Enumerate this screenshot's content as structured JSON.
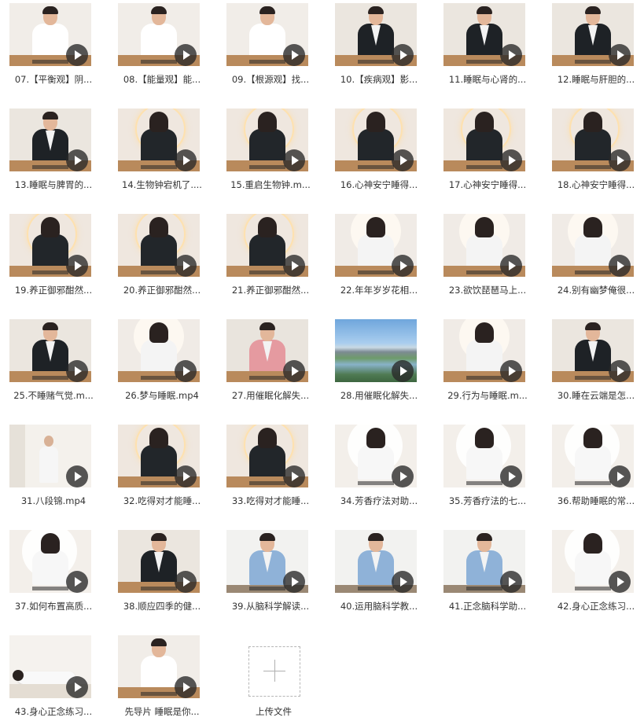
{
  "files": [
    {
      "name": "07.【平衡观】阴...",
      "scene": "man-navy"
    },
    {
      "name": "08.【能量观】能...",
      "scene": "man-navy"
    },
    {
      "name": "09.【根源观】找...",
      "scene": "man-navy"
    },
    {
      "name": "10.【疾病观】影...",
      "scene": "man-dark"
    },
    {
      "name": "11.睡眠与心肾的...",
      "scene": "man-dark"
    },
    {
      "name": "12.睡眠与肝胆的...",
      "scene": "man-dark"
    },
    {
      "name": "13.睡眠与脾胃的...",
      "scene": "man-dark"
    },
    {
      "name": "14.生物钟宕机了....",
      "scene": "woman-dark"
    },
    {
      "name": "15.重启生物钟.m...",
      "scene": "woman-dark"
    },
    {
      "name": "16.心神安宁睡得...",
      "scene": "woman-dark"
    },
    {
      "name": "17.心神安宁睡得...",
      "scene": "woman-dark"
    },
    {
      "name": "18.心神安宁睡得...",
      "scene": "woman-dark"
    },
    {
      "name": "19.养正御邪酣然...",
      "scene": "woman-dark"
    },
    {
      "name": "20.养正御邪酣然...",
      "scene": "woman-dark"
    },
    {
      "name": "21.养正御邪酣然...",
      "scene": "woman-dark"
    },
    {
      "name": "22.年年岁岁花相...",
      "scene": "woman-light"
    },
    {
      "name": "23.欲饮琵琶马上...",
      "scene": "woman-light"
    },
    {
      "name": "24.别有幽梦俺很...",
      "scene": "woman-light"
    },
    {
      "name": "25.不睡赌气觉.m...",
      "scene": "man-dark"
    },
    {
      "name": "26.梦与睡眠.mp4",
      "scene": "woman-light"
    },
    {
      "name": "27.用催眠化解失...",
      "scene": "man-pink"
    },
    {
      "name": "28.用催眠化解失...",
      "scene": "landscape"
    },
    {
      "name": "29.行为与睡眠.m...",
      "scene": "woman-light"
    },
    {
      "name": "30.睡在云端是怎...",
      "scene": "man-dark"
    },
    {
      "name": "31.八段锦.mp4",
      "scene": "woman-standing"
    },
    {
      "name": "32.吃得对才能睡...",
      "scene": "woman-dark"
    },
    {
      "name": "33.吃得对才能睡...",
      "scene": "woman-dark"
    },
    {
      "name": "34.芳香疗法对助...",
      "scene": "woman-white"
    },
    {
      "name": "35.芳香疗法的七...",
      "scene": "woman-white"
    },
    {
      "name": "36.帮助睡眠的常...",
      "scene": "woman-white"
    },
    {
      "name": "37.如何布置高质...",
      "scene": "woman-white"
    },
    {
      "name": "38.顺应四季的健...",
      "scene": "man-dark"
    },
    {
      "name": "39.从脑科学解读...",
      "scene": "man-blue"
    },
    {
      "name": "40.运用脑科学教...",
      "scene": "man-blue"
    },
    {
      "name": "41.正念脑科学助...",
      "scene": "man-blue"
    },
    {
      "name": "42.身心正念练习...",
      "scene": "woman-white"
    },
    {
      "name": "43.身心正念练习...",
      "scene": "woman-lying"
    },
    {
      "name": "先导片  睡眠是你...",
      "scene": "man-navy"
    }
  ],
  "upload": {
    "label": "上传文件",
    "icon": "plus-icon"
  }
}
